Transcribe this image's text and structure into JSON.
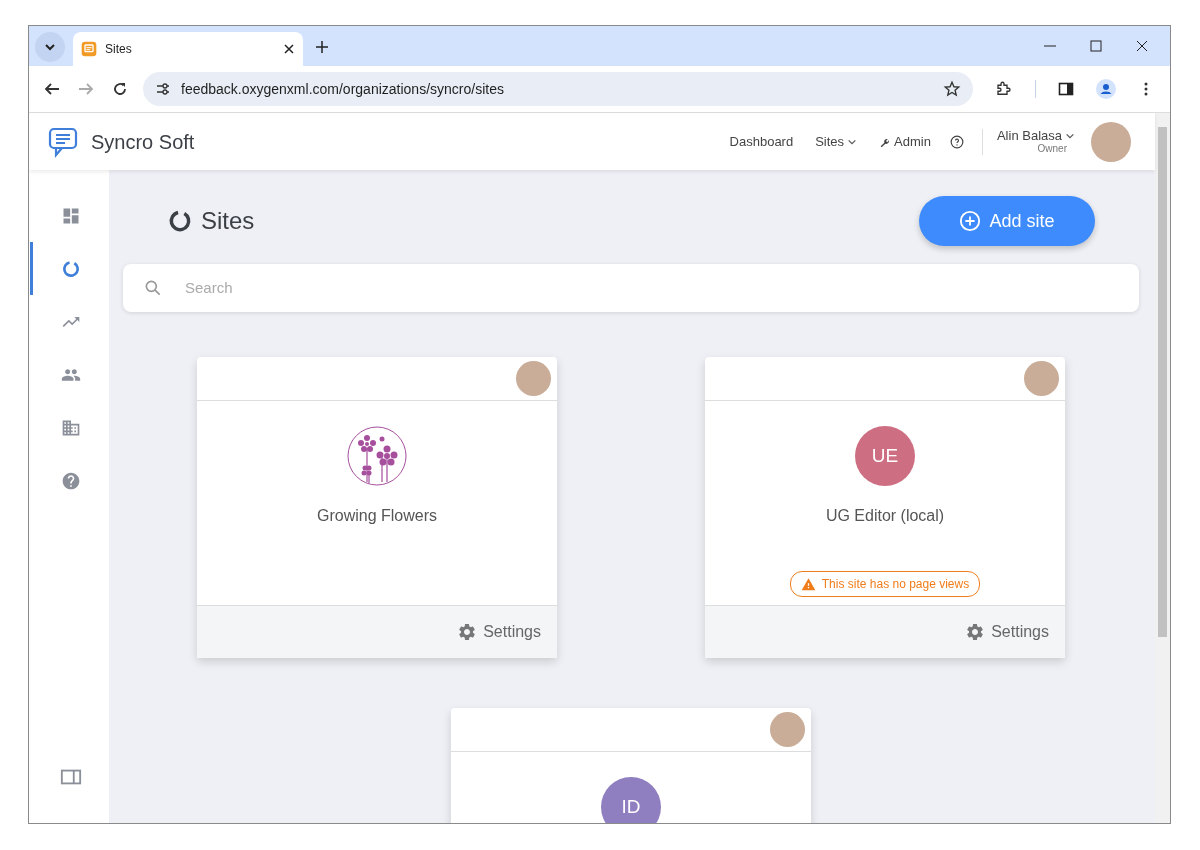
{
  "browser": {
    "tab_title": "Sites",
    "url": "feedback.oxygenxml.com/organizations/syncro/sites",
    "forward_disabled": true
  },
  "header": {
    "brand": "Syncro Soft",
    "nav": [
      {
        "label": "Dashboard",
        "kind": "link"
      },
      {
        "label": "Sites",
        "kind": "dropdown"
      },
      {
        "label": "Admin",
        "kind": "admin"
      }
    ],
    "user": {
      "name": "Alin Balasa",
      "role": "Owner"
    }
  },
  "sidebar": {
    "items": [
      {
        "kind": "dashboard",
        "selected": false
      },
      {
        "kind": "sites",
        "selected": true
      },
      {
        "kind": "analytics",
        "selected": false
      },
      {
        "kind": "users",
        "selected": false
      },
      {
        "kind": "organization",
        "selected": false
      },
      {
        "kind": "help",
        "selected": false
      }
    ]
  },
  "page": {
    "title": "Sites",
    "add_button": "Add site",
    "search": {
      "placeholder": "Search"
    }
  },
  "sites": [
    {
      "kind": "image",
      "name": "Growing Flowers",
      "settings": "Settings"
    },
    {
      "kind": "initials",
      "initials": "UE",
      "color": "#cd6e82",
      "name": "UG Editor (local)",
      "warning": "This site has no page views",
      "settings": "Settings"
    },
    {
      "kind": "initials",
      "initials": "ID",
      "color": "#8f7ec0"
    }
  ]
}
